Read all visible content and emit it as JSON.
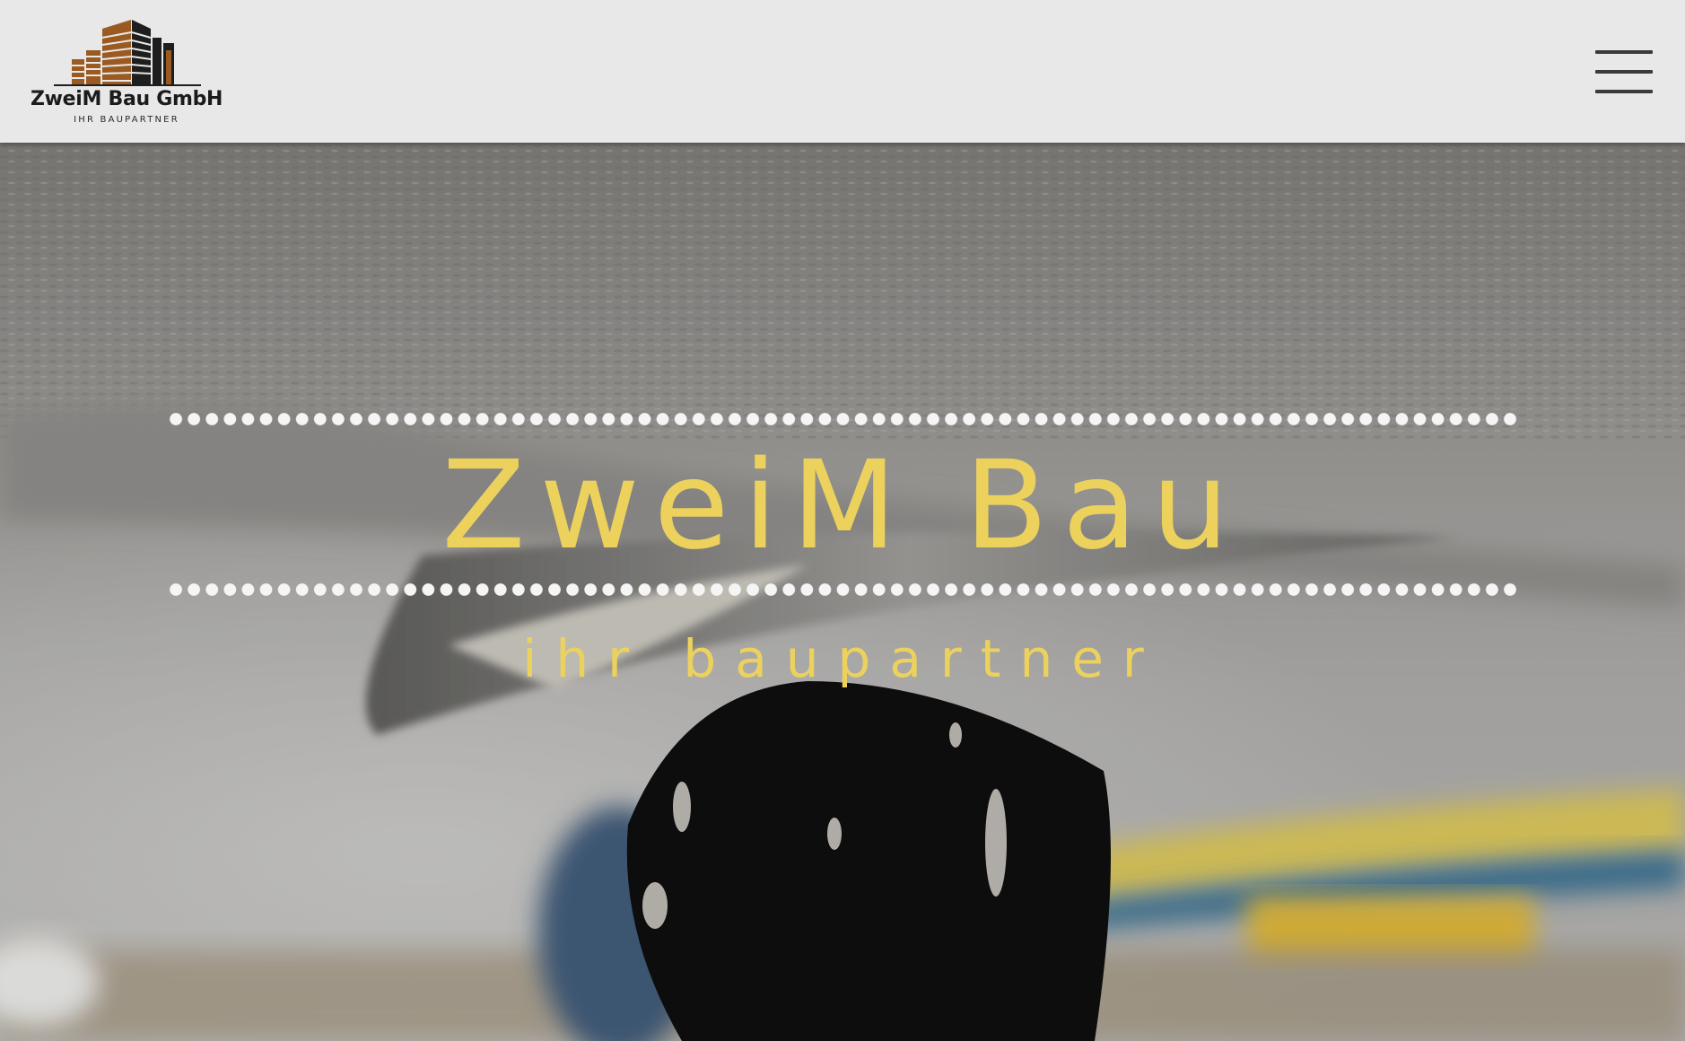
{
  "header": {
    "logo": {
      "name": "ZweiM Bau GmbH",
      "tagline": "IHR BAUPARTNER",
      "icon": "building-icon",
      "colors": {
        "brown": "#9a5a22",
        "dark": "#1e1e1e"
      }
    },
    "menu": {
      "icon": "hamburger-menu-icon"
    }
  },
  "hero": {
    "title": "ZweiM Bau",
    "subtitle": "ihr baupartner",
    "accent_color": "#ecd25d",
    "background": "plastering-trowel-on-ceiling-photo"
  }
}
